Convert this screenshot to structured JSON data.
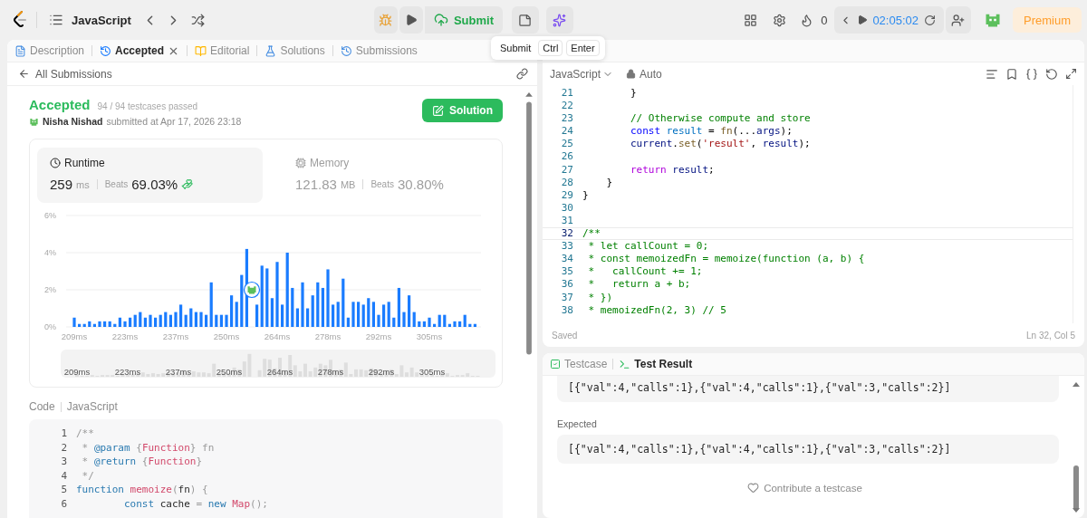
{
  "topbar": {
    "title": "JavaScript",
    "submit": "Submit",
    "streak": "0",
    "timer": "02:05:02",
    "premium": "Premium"
  },
  "tooltip": {
    "label": "Submit",
    "keys": [
      "Ctrl",
      "Enter"
    ]
  },
  "tabs": [
    {
      "label": "Description",
      "selected": false,
      "closable": false
    },
    {
      "label": "Accepted",
      "selected": true,
      "closable": true
    },
    {
      "label": "Editorial",
      "selected": false,
      "closable": false
    },
    {
      "label": "Solutions",
      "selected": false,
      "closable": false
    },
    {
      "label": "Submissions",
      "selected": false,
      "closable": false
    }
  ],
  "submission": {
    "back": "All Submissions",
    "status": "Accepted",
    "testcases": "94 / 94 testcases passed",
    "user": "Nisha Nishad",
    "submitted": "submitted at Apr 17, 2026 23:18",
    "solution_button": "Solution"
  },
  "stats": [
    {
      "title": "Runtime",
      "value": "259",
      "unit": "ms",
      "beats_label": "Beats",
      "beats": "69.03%",
      "selected": true
    },
    {
      "title": "Memory",
      "value": "121.83",
      "unit": "MB",
      "beats_label": "Beats",
      "beats": "30.80%",
      "selected": false
    }
  ],
  "chart_data": {
    "type": "bar",
    "ylim": [
      0,
      6
    ],
    "yticks": [
      {
        "value": 0,
        "label": "0%"
      },
      {
        "value": 2,
        "label": "2%"
      },
      {
        "value": 4,
        "label": "4%"
      },
      {
        "value": 6,
        "label": "6%"
      }
    ],
    "categories": [
      "209ms",
      null,
      null,
      null,
      null,
      null,
      null,
      null,
      null,
      null,
      "223ms",
      null,
      null,
      null,
      null,
      null,
      null,
      null,
      null,
      null,
      "237ms",
      null,
      null,
      null,
      null,
      null,
      null,
      null,
      null,
      null,
      "250ms",
      null,
      null,
      null,
      null,
      null,
      null,
      null,
      null,
      null,
      "264ms",
      null,
      null,
      null,
      null,
      null,
      null,
      null,
      null,
      null,
      "278ms",
      null,
      null,
      null,
      null,
      null,
      null,
      null,
      null,
      null,
      "292ms",
      null,
      null,
      null,
      null,
      null,
      null,
      null,
      null,
      null,
      "305ms",
      null,
      null,
      null,
      null,
      null,
      null,
      null,
      null,
      null
    ],
    "series": [
      {
        "color": "#1a7cff",
        "values": [
          0.5,
          0.16,
          0.16,
          0.3,
          0.16,
          0.3,
          0.3,
          0.3,
          0.16,
          0.5,
          0.3,
          0.5,
          0.65,
          0.8,
          0.5,
          0.65,
          0.5,
          0.65,
          0.8,
          0.65,
          0.8,
          1.2,
          0.65,
          1.0,
          0.8,
          0.8,
          0.65,
          2.4,
          0.65,
          0.65,
          0.65,
          1.7,
          1.35,
          2.8,
          4.2,
          null,
          1.2,
          3.3,
          3.15,
          1.55,
          3.5,
          1.2,
          4.0,
          2.1,
          1.0,
          2.4,
          1.0,
          1.7,
          2.4,
          2.1,
          3.1,
          1.2,
          1.35,
          2.6,
          0.5,
          1.35,
          1.35,
          1.2,
          1.55,
          1.35,
          0.65,
          1.2,
          1.35,
          0.5,
          2.1,
          0.8,
          1.7,
          0.8,
          0.3,
          0.3,
          0.5,
          0.16,
          0.65,
          0.65,
          0.16,
          0.3,
          0.3,
          0.65,
          0.16,
          0.16
        ]
      }
    ]
  },
  "navigator": {
    "labels": [
      "209ms",
      "223ms",
      "237ms",
      "250ms",
      "264ms",
      "278ms",
      "292ms",
      "305ms"
    ]
  },
  "code": {
    "label": "Code",
    "language": "JavaScript",
    "lines": [
      {
        "n": "1",
        "tokens": [
          {
            "text": "/**",
            "kind": "cm"
          }
        ]
      },
      {
        "n": "2",
        "tokens": [
          {
            "text": " * ",
            "kind": "cm"
          },
          {
            "text": "@param",
            "kind": "tag"
          },
          {
            "text": " {",
            "kind": "cm"
          },
          {
            "text": "Function",
            "kind": "type"
          },
          {
            "text": "} fn",
            "kind": "cm"
          }
        ]
      },
      {
        "n": "3",
        "tokens": [
          {
            "text": " * ",
            "kind": "cm"
          },
          {
            "text": "@return",
            "kind": "tag"
          },
          {
            "text": " {",
            "kind": "cm"
          },
          {
            "text": "Function",
            "kind": "type"
          },
          {
            "text": "}",
            "kind": "cm"
          }
        ]
      },
      {
        "n": "4",
        "tokens": [
          {
            "text": " */",
            "kind": "cm"
          }
        ]
      },
      {
        "n": "5",
        "tokens": [
          {
            "text": "function",
            "kind": "kw"
          },
          {
            "text": " memoize",
            "kind": "fn"
          },
          {
            "text": "(",
            "kind": "cm"
          },
          {
            "text": "fn",
            "kind": "pl"
          },
          {
            "text": ") {",
            "kind": "cm"
          }
        ]
      },
      {
        "n": "6",
        "tokens": [
          {
            "text": "        const",
            "kind": "kw"
          },
          {
            "text": " cache ",
            "kind": "pl"
          },
          {
            "text": "=",
            "kind": "cm"
          },
          {
            "text": " new",
            "kind": "kw"
          },
          {
            "text": " Map",
            "kind": "fn"
          },
          {
            "text": "();",
            "kind": "cm"
          }
        ]
      }
    ]
  },
  "editor": {
    "language": "JavaScript",
    "mode": "Auto",
    "status": "Saved",
    "cursor": "Ln 32, Col 5",
    "lines": [
      {
        "n": "21",
        "active": false,
        "tokens": [
          {
            "text": "        }",
            "kind": "pl"
          }
        ]
      },
      {
        "n": "22",
        "active": false
      },
      {
        "n": "23",
        "active": false,
        "tokens": [
          {
            "text": "        // Otherwise compute and store",
            "kind": "cm"
          }
        ]
      },
      {
        "n": "24",
        "active": false,
        "tokens": [
          {
            "text": "        const",
            "kind": "kw"
          },
          {
            "text": " result",
            "kind": "var"
          },
          {
            "text": " = ",
            "kind": "pl"
          },
          {
            "text": "fn",
            "kind": "fn"
          },
          {
            "text": "(...",
            "kind": "pl"
          },
          {
            "text": "args",
            "kind": "param"
          },
          {
            "text": ");",
            "kind": "pl"
          }
        ]
      },
      {
        "n": "25",
        "active": false,
        "tokens": [
          {
            "text": "        current",
            "kind": "param"
          },
          {
            "text": ".",
            "kind": "pl"
          },
          {
            "text": "set",
            "kind": "fn"
          },
          {
            "text": "(",
            "kind": "pl"
          },
          {
            "text": "'result'",
            "kind": "str"
          },
          {
            "text": ", ",
            "kind": "pl"
          },
          {
            "text": "result",
            "kind": "param"
          },
          {
            "text": ");",
            "kind": "pl"
          }
        ]
      },
      {
        "n": "26",
        "active": false
      },
      {
        "n": "27",
        "active": false,
        "tokens": [
          {
            "text": "        return",
            "kind": "ctl"
          },
          {
            "text": " result",
            "kind": "param"
          },
          {
            "text": ";",
            "kind": "pl"
          }
        ]
      },
      {
        "n": "28",
        "active": false,
        "tokens": [
          {
            "text": "    }",
            "kind": "pl"
          }
        ]
      },
      {
        "n": "29",
        "active": false,
        "tokens": [
          {
            "text": "}",
            "kind": "pl"
          }
        ]
      },
      {
        "n": "30",
        "active": false
      },
      {
        "n": "31",
        "active": false
      },
      {
        "n": "32",
        "active": true,
        "tokens": [
          {
            "text": "/**",
            "kind": "cm"
          }
        ]
      },
      {
        "n": "33",
        "active": false,
        "tokens": [
          {
            "text": " * let callCount = 0;",
            "kind": "cm"
          }
        ]
      },
      {
        "n": "34",
        "active": false,
        "tokens": [
          {
            "text": " * const memoizedFn = memoize(function (a, b) {",
            "kind": "cm"
          }
        ]
      },
      {
        "n": "35",
        "active": false,
        "tokens": [
          {
            "text": " *   callCount += 1;",
            "kind": "cm"
          }
        ]
      },
      {
        "n": "36",
        "active": false,
        "tokens": [
          {
            "text": " *   return a + b;",
            "kind": "cm"
          }
        ]
      },
      {
        "n": "37",
        "active": false,
        "tokens": [
          {
            "text": " * })",
            "kind": "cm"
          }
        ]
      },
      {
        "n": "38",
        "active": false,
        "tokens": [
          {
            "text": " * memoizedFn(2, 3) // 5",
            "kind": "cm"
          }
        ]
      }
    ]
  },
  "result_tabs": [
    {
      "label": "Testcase",
      "selected": false
    },
    {
      "label": "Test Result",
      "selected": true
    }
  ],
  "result": {
    "output": "[{\"val\":4,\"calls\":1},{\"val\":4,\"calls\":1},{\"val\":3,\"calls\":2}]",
    "expected_label": "Expected",
    "expected": "[{\"val\":4,\"calls\":1},{\"val\":4,\"calls\":1},{\"val\":3,\"calls\":2}]",
    "contribute": "Contribute a testcase"
  }
}
